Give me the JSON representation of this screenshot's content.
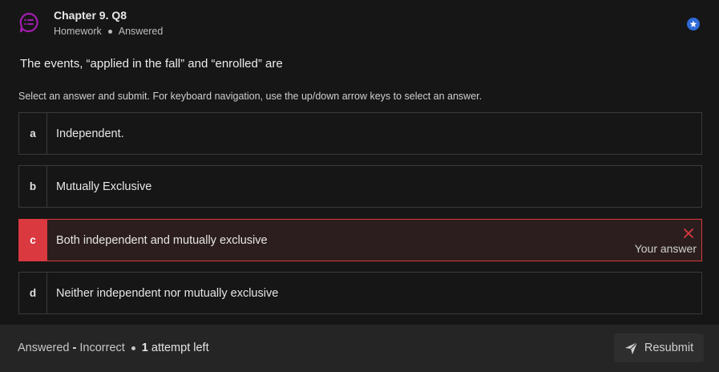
{
  "header": {
    "title": "Chapter 9. Q8",
    "type": "Homework",
    "status": "Answered",
    "logo_icon": "chat-list-icon",
    "badge_icon": "star-icon"
  },
  "question": {
    "text": "The events, “applied in the fall” and “enrolled” are",
    "instructions": "Select an answer and submit. For keyboard navigation, use the up/down arrow keys to select an answer."
  },
  "options": [
    {
      "letter": "a",
      "text": "Independent."
    },
    {
      "letter": "b",
      "text": "Mutually Exclusive"
    },
    {
      "letter": "c",
      "text": "Both independent and mutually exclusive",
      "selected": true,
      "incorrect": true,
      "note": "Your answer"
    },
    {
      "letter": "d",
      "text": "Neither independent nor mutually exclusive"
    }
  ],
  "footer": {
    "result_prefix": "Answered",
    "result_sep": " - ",
    "result": "Incorrect",
    "attempts_count": "1",
    "attempts_label": "attempt left",
    "resubmit_label": "Resubmit"
  },
  "colors": {
    "background": "#161616",
    "error": "#d9393f",
    "accent_badge": "#2f6ad9",
    "logo": "#a21caf"
  }
}
